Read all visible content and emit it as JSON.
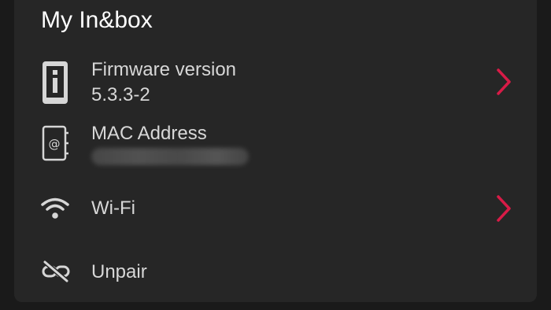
{
  "screen": {
    "title": "My In&box"
  },
  "items": [
    {
      "label": "Firmware version",
      "value": "5.3.3-2",
      "icon": "info-icon",
      "has_chevron": true
    },
    {
      "label": "MAC Address",
      "value": "",
      "icon": "address-book-icon",
      "has_chevron": false
    },
    {
      "label": "Wi-Fi",
      "icon": "wifi-icon",
      "has_chevron": true
    },
    {
      "label": "Unpair",
      "icon": "unlink-icon",
      "has_chevron": false
    }
  ],
  "colors": {
    "background": "#1a1a1a",
    "card": "#262626",
    "text": "#d7d7d7",
    "accent": "#d81b47"
  }
}
